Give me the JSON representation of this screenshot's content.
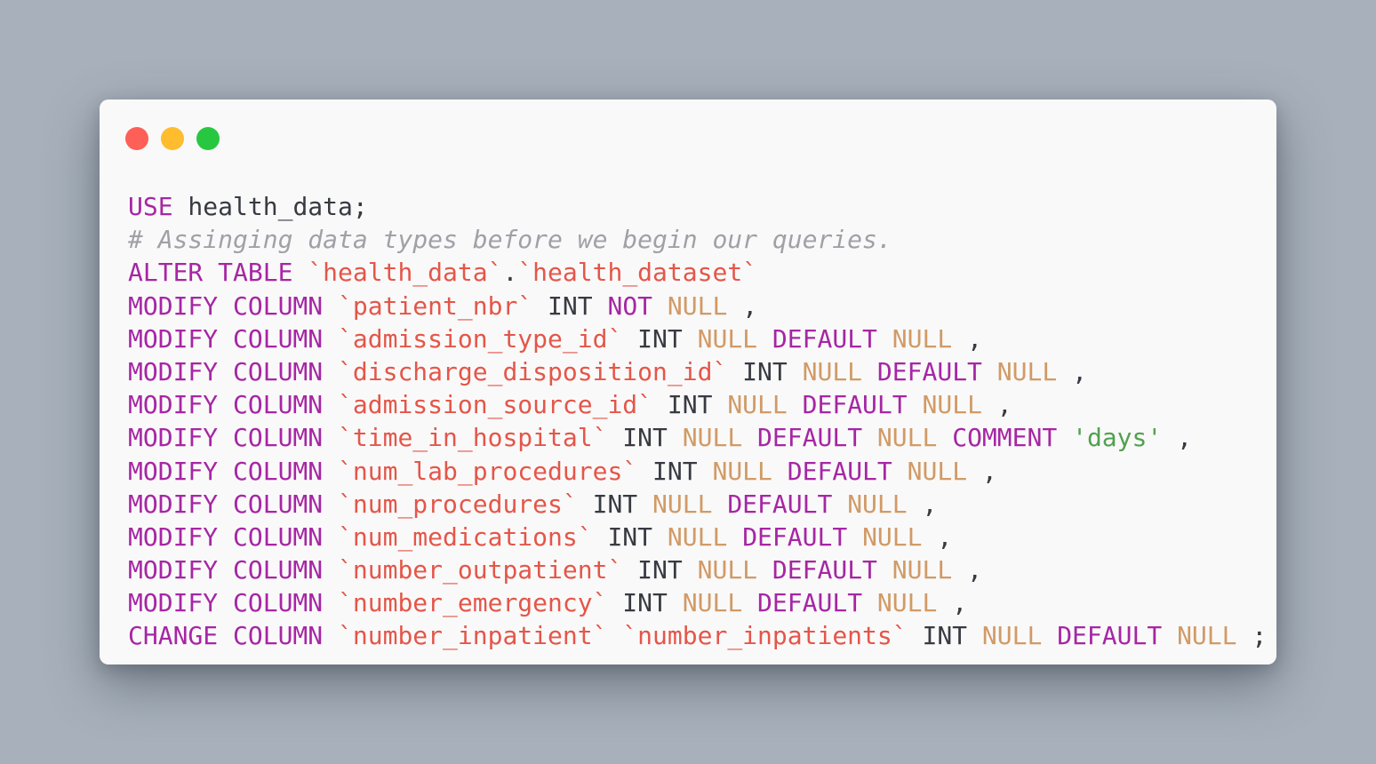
{
  "window": {
    "controls": [
      {
        "name": "close",
        "color": "#fe5f57"
      },
      {
        "name": "minimize",
        "color": "#febc2e"
      },
      {
        "name": "maximize",
        "color": "#27c840"
      }
    ]
  },
  "colors": {
    "background": "#a8b1bb",
    "window": "#f9f9f9",
    "keyword": "#a626a4",
    "identifier": "#e45649",
    "null_literal": "#d19a66",
    "string": "#50a14f",
    "comment": "#a0a1a7",
    "plain": "#383a42"
  },
  "code": {
    "lines": [
      [
        {
          "t": "keyword",
          "v": "USE"
        },
        {
          "t": "plain",
          "v": " health_data;"
        }
      ],
      [
        {
          "t": "comment",
          "v": "# Assinging data types before we begin our queries."
        }
      ],
      [
        {
          "t": "keyword",
          "v": "ALTER TABLE"
        },
        {
          "t": "plain",
          "v": " "
        },
        {
          "t": "ident",
          "v": "`health_data`"
        },
        {
          "t": "plain",
          "v": "."
        },
        {
          "t": "ident",
          "v": "`health_dataset`"
        }
      ],
      [
        {
          "t": "keyword",
          "v": "MODIFY COLUMN"
        },
        {
          "t": "plain",
          "v": " "
        },
        {
          "t": "ident",
          "v": "`patient_nbr`"
        },
        {
          "t": "plain",
          "v": " INT "
        },
        {
          "t": "keyword",
          "v": "NOT"
        },
        {
          "t": "plain",
          "v": " "
        },
        {
          "t": "null",
          "v": "NULL"
        },
        {
          "t": "plain",
          "v": " ,"
        }
      ],
      [
        {
          "t": "keyword",
          "v": "MODIFY COLUMN"
        },
        {
          "t": "plain",
          "v": " "
        },
        {
          "t": "ident",
          "v": "`admission_type_id`"
        },
        {
          "t": "plain",
          "v": " INT "
        },
        {
          "t": "null",
          "v": "NULL"
        },
        {
          "t": "plain",
          "v": " "
        },
        {
          "t": "keyword",
          "v": "DEFAULT"
        },
        {
          "t": "plain",
          "v": " "
        },
        {
          "t": "null",
          "v": "NULL"
        },
        {
          "t": "plain",
          "v": " ,"
        }
      ],
      [
        {
          "t": "keyword",
          "v": "MODIFY COLUMN"
        },
        {
          "t": "plain",
          "v": " "
        },
        {
          "t": "ident",
          "v": "`discharge_disposition_id`"
        },
        {
          "t": "plain",
          "v": " INT "
        },
        {
          "t": "null",
          "v": "NULL"
        },
        {
          "t": "plain",
          "v": " "
        },
        {
          "t": "keyword",
          "v": "DEFAULT"
        },
        {
          "t": "plain",
          "v": " "
        },
        {
          "t": "null",
          "v": "NULL"
        },
        {
          "t": "plain",
          "v": " ,"
        }
      ],
      [
        {
          "t": "keyword",
          "v": "MODIFY COLUMN"
        },
        {
          "t": "plain",
          "v": " "
        },
        {
          "t": "ident",
          "v": "`admission_source_id`"
        },
        {
          "t": "plain",
          "v": " INT "
        },
        {
          "t": "null",
          "v": "NULL"
        },
        {
          "t": "plain",
          "v": " "
        },
        {
          "t": "keyword",
          "v": "DEFAULT"
        },
        {
          "t": "plain",
          "v": " "
        },
        {
          "t": "null",
          "v": "NULL"
        },
        {
          "t": "plain",
          "v": " ,"
        }
      ],
      [
        {
          "t": "keyword",
          "v": "MODIFY COLUMN"
        },
        {
          "t": "plain",
          "v": " "
        },
        {
          "t": "ident",
          "v": "`time_in_hospital`"
        },
        {
          "t": "plain",
          "v": " INT "
        },
        {
          "t": "null",
          "v": "NULL"
        },
        {
          "t": "plain",
          "v": " "
        },
        {
          "t": "keyword",
          "v": "DEFAULT"
        },
        {
          "t": "plain",
          "v": " "
        },
        {
          "t": "null",
          "v": "NULL"
        },
        {
          "t": "plain",
          "v": " "
        },
        {
          "t": "keyword",
          "v": "COMMENT"
        },
        {
          "t": "plain",
          "v": " "
        },
        {
          "t": "string",
          "v": "'days'"
        },
        {
          "t": "plain",
          "v": " ,"
        }
      ],
      [
        {
          "t": "keyword",
          "v": "MODIFY COLUMN"
        },
        {
          "t": "plain",
          "v": " "
        },
        {
          "t": "ident",
          "v": "`num_lab_procedures`"
        },
        {
          "t": "plain",
          "v": " INT "
        },
        {
          "t": "null",
          "v": "NULL"
        },
        {
          "t": "plain",
          "v": " "
        },
        {
          "t": "keyword",
          "v": "DEFAULT"
        },
        {
          "t": "plain",
          "v": " "
        },
        {
          "t": "null",
          "v": "NULL"
        },
        {
          "t": "plain",
          "v": " ,"
        }
      ],
      [
        {
          "t": "keyword",
          "v": "MODIFY COLUMN"
        },
        {
          "t": "plain",
          "v": " "
        },
        {
          "t": "ident",
          "v": "`num_procedures`"
        },
        {
          "t": "plain",
          "v": " INT "
        },
        {
          "t": "null",
          "v": "NULL"
        },
        {
          "t": "plain",
          "v": " "
        },
        {
          "t": "keyword",
          "v": "DEFAULT"
        },
        {
          "t": "plain",
          "v": " "
        },
        {
          "t": "null",
          "v": "NULL"
        },
        {
          "t": "plain",
          "v": " ,"
        }
      ],
      [
        {
          "t": "keyword",
          "v": "MODIFY COLUMN"
        },
        {
          "t": "plain",
          "v": " "
        },
        {
          "t": "ident",
          "v": "`num_medications`"
        },
        {
          "t": "plain",
          "v": " INT "
        },
        {
          "t": "null",
          "v": "NULL"
        },
        {
          "t": "plain",
          "v": " "
        },
        {
          "t": "keyword",
          "v": "DEFAULT"
        },
        {
          "t": "plain",
          "v": " "
        },
        {
          "t": "null",
          "v": "NULL"
        },
        {
          "t": "plain",
          "v": " ,"
        }
      ],
      [
        {
          "t": "keyword",
          "v": "MODIFY COLUMN"
        },
        {
          "t": "plain",
          "v": " "
        },
        {
          "t": "ident",
          "v": "`number_outpatient`"
        },
        {
          "t": "plain",
          "v": " INT "
        },
        {
          "t": "null",
          "v": "NULL"
        },
        {
          "t": "plain",
          "v": " "
        },
        {
          "t": "keyword",
          "v": "DEFAULT"
        },
        {
          "t": "plain",
          "v": " "
        },
        {
          "t": "null",
          "v": "NULL"
        },
        {
          "t": "plain",
          "v": " ,"
        }
      ],
      [
        {
          "t": "keyword",
          "v": "MODIFY COLUMN"
        },
        {
          "t": "plain",
          "v": " "
        },
        {
          "t": "ident",
          "v": "`number_emergency`"
        },
        {
          "t": "plain",
          "v": " INT "
        },
        {
          "t": "null",
          "v": "NULL"
        },
        {
          "t": "plain",
          "v": " "
        },
        {
          "t": "keyword",
          "v": "DEFAULT"
        },
        {
          "t": "plain",
          "v": " "
        },
        {
          "t": "null",
          "v": "NULL"
        },
        {
          "t": "plain",
          "v": " ,"
        }
      ],
      [
        {
          "t": "keyword",
          "v": "CHANGE COLUMN"
        },
        {
          "t": "plain",
          "v": " "
        },
        {
          "t": "ident",
          "v": "`number_inpatient`"
        },
        {
          "t": "plain",
          "v": " "
        },
        {
          "t": "ident",
          "v": "`number_inpatients`"
        },
        {
          "t": "plain",
          "v": " INT "
        },
        {
          "t": "null",
          "v": "NULL"
        },
        {
          "t": "plain",
          "v": " "
        },
        {
          "t": "keyword",
          "v": "DEFAULT"
        },
        {
          "t": "plain",
          "v": " "
        },
        {
          "t": "null",
          "v": "NULL"
        },
        {
          "t": "plain",
          "v": " ;"
        }
      ]
    ]
  }
}
